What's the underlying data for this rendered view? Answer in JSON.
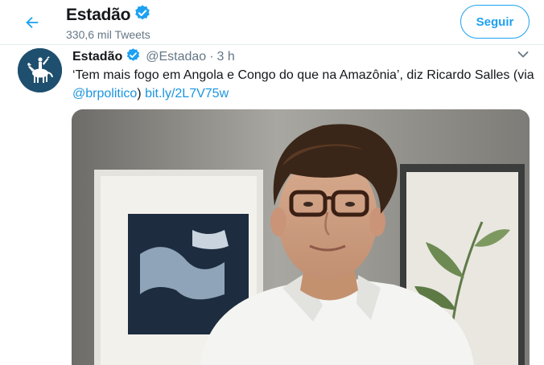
{
  "header": {
    "name": "Estadão",
    "tweet_count": "330,6 mil Tweets",
    "follow_label": "Seguir"
  },
  "tweet": {
    "name": "Estadão",
    "handle": "@Estadao",
    "separator": "·",
    "time": "3 h",
    "text_part1": "‘Tem mais fogo em Angola e Congo do que na Amazônia’, diz Ricardo Salles (via ",
    "mention": "@brpolitico",
    "text_part2": ") ",
    "url": "bit.ly/2L7V75w"
  },
  "colors": {
    "accent": "#1da1f2",
    "link": "#1b95e0",
    "secondary_text": "#657786",
    "avatar_bg": "#1f4f6e"
  },
  "icons": {
    "back": "arrow-left-icon",
    "verified": "verified-badge-icon",
    "caret": "chevron-down-icon"
  }
}
